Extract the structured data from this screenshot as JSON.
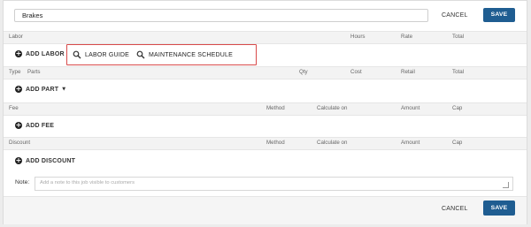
{
  "job": {
    "name": "Brakes"
  },
  "header": {
    "cancel_label": "CANCEL",
    "save_label": "SAVE"
  },
  "labor": {
    "section_label": "Labor",
    "columns": [
      "Hours",
      "Rate",
      "Total"
    ],
    "add_label": "ADD LABOR",
    "guide_label": "LABOR GUIDE",
    "schedule_label": "MAINTENANCE SCHEDULE"
  },
  "parts": {
    "columns": [
      "Type",
      "Parts",
      "Qty",
      "Cost",
      "Retail",
      "Total"
    ],
    "add_label": "ADD PART"
  },
  "fees": {
    "columns": [
      "Fee",
      "Method",
      "Calculate on",
      "Amount",
      "Cap"
    ],
    "add_label": "ADD FEE"
  },
  "discounts": {
    "columns": [
      "Discount",
      "Method",
      "Calculate on",
      "Amount",
      "Cap"
    ],
    "add_label": "ADD DISCOUNT"
  },
  "note": {
    "label": "Note:",
    "placeholder": "Add a note to this job visible to customers"
  },
  "footer": {
    "cancel_label": "CANCEL",
    "save_label": "SAVE"
  },
  "icons": {
    "add": "plus-circle-icon",
    "search": "search-icon",
    "caret": "caret-down-icon"
  },
  "colors": {
    "primary": "#1f5d91",
    "highlight_box": "#d84a4a"
  }
}
